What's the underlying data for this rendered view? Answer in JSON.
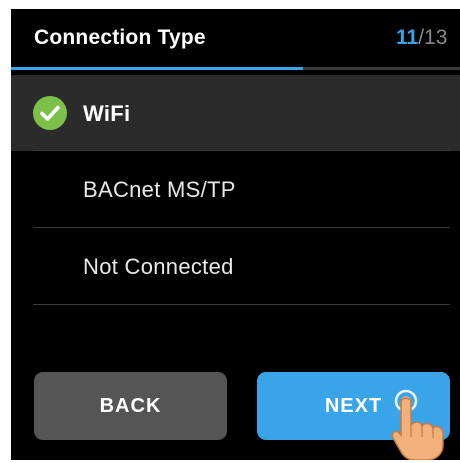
{
  "header": {
    "title": "Connection Type",
    "step_current": "11",
    "step_separator": "/",
    "step_total": "13",
    "progress_fraction": 0.65
  },
  "options": [
    {
      "label": "WiFi",
      "selected": true,
      "icon": "check-circle-icon"
    },
    {
      "label": "BACnet MS/TP",
      "selected": false
    },
    {
      "label": "Not Connected",
      "selected": false
    }
  ],
  "buttons": {
    "back_label": "BACK",
    "next_label": "NEXT"
  },
  "colors": {
    "accent": "#3aa4e8",
    "check": "#7cc04a",
    "back_button": "#555555",
    "selected_row": "#2b2b2b"
  }
}
